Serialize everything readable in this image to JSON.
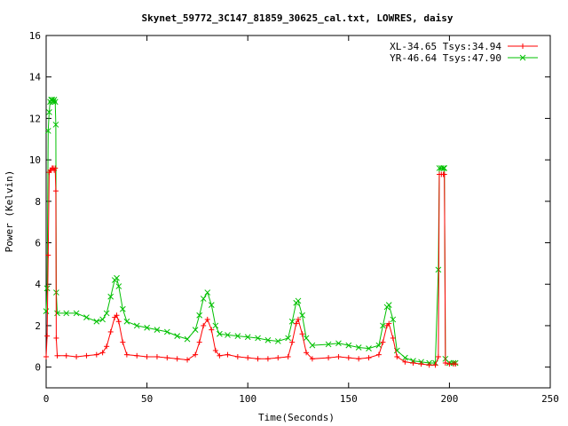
{
  "chart_data": {
    "type": "line",
    "title": "Skynet_59772_3C147_81859_30625_cal.txt, LOWRES, daisy",
    "xlabel": "Time(Seconds)",
    "ylabel": "Power (Kelvin)",
    "xlim": [
      0,
      250
    ],
    "ylim": [
      -1,
      16
    ],
    "xticks": [
      0,
      50,
      100,
      150,
      200,
      250
    ],
    "yticks": [
      0,
      2,
      4,
      6,
      8,
      10,
      12,
      14,
      16
    ],
    "grid": false,
    "legend_position": "top-right",
    "series": [
      {
        "name": "XL-34.65 Tsys:34.94",
        "color": "#ff0000",
        "marker": "plus",
        "points": [
          [
            0,
            0.5
          ],
          [
            0.5,
            1.5
          ],
          [
            1,
            5.4
          ],
          [
            1.5,
            9.4
          ],
          [
            2,
            9.5
          ],
          [
            2.5,
            9.5
          ],
          [
            3,
            9.6
          ],
          [
            3.5,
            9.6
          ],
          [
            4,
            9.5
          ],
          [
            4.5,
            9.6
          ],
          [
            4.8,
            8.5
          ],
          [
            5,
            1.4
          ],
          [
            5.5,
            0.55
          ],
          [
            10,
            0.55
          ],
          [
            15,
            0.5
          ],
          [
            20,
            0.55
          ],
          [
            25,
            0.6
          ],
          [
            28,
            0.7
          ],
          [
            30,
            1.0
          ],
          [
            32,
            1.7
          ],
          [
            34,
            2.4
          ],
          [
            35,
            2.5
          ],
          [
            36,
            2.2
          ],
          [
            38,
            1.2
          ],
          [
            40,
            0.6
          ],
          [
            45,
            0.55
          ],
          [
            50,
            0.5
          ],
          [
            55,
            0.5
          ],
          [
            60,
            0.45
          ],
          [
            65,
            0.4
          ],
          [
            70,
            0.35
          ],
          [
            74,
            0.6
          ],
          [
            76,
            1.2
          ],
          [
            78,
            2.0
          ],
          [
            80,
            2.3
          ],
          [
            82,
            1.8
          ],
          [
            84,
            0.8
          ],
          [
            86,
            0.55
          ],
          [
            90,
            0.6
          ],
          [
            95,
            0.5
          ],
          [
            100,
            0.45
          ],
          [
            105,
            0.4
          ],
          [
            110,
            0.4
          ],
          [
            115,
            0.45
          ],
          [
            120,
            0.5
          ],
          [
            122,
            1.2
          ],
          [
            124,
            2.1
          ],
          [
            125,
            2.3
          ],
          [
            127,
            1.6
          ],
          [
            129,
            0.7
          ],
          [
            132,
            0.4
          ],
          [
            140,
            0.45
          ],
          [
            145,
            0.5
          ],
          [
            150,
            0.45
          ],
          [
            155,
            0.4
          ],
          [
            160,
            0.45
          ],
          [
            165,
            0.6
          ],
          [
            167,
            1.2
          ],
          [
            169,
            2.0
          ],
          [
            170,
            2.1
          ],
          [
            172,
            1.4
          ],
          [
            174,
            0.5
          ],
          [
            178,
            0.25
          ],
          [
            182,
            0.2
          ],
          [
            186,
            0.15
          ],
          [
            190,
            0.1
          ],
          [
            193,
            0.1
          ],
          [
            194.5,
            0.5
          ],
          [
            195,
            9.3
          ],
          [
            196,
            9.3
          ],
          [
            197,
            9.3
          ],
          [
            197.5,
            9.3
          ],
          [
            198,
            0.2
          ],
          [
            200,
            0.15
          ],
          [
            202,
            0.15
          ],
          [
            203,
            0.15
          ]
        ]
      },
      {
        "name": "YR-46.64 Tsys:47.90",
        "color": "#00c000",
        "marker": "x",
        "points": [
          [
            0,
            2.7
          ],
          [
            0.5,
            3.8
          ],
          [
            1,
            11.4
          ],
          [
            1.5,
            12.3
          ],
          [
            2,
            12.8
          ],
          [
            2.5,
            12.9
          ],
          [
            3,
            12.9
          ],
          [
            3.5,
            12.8
          ],
          [
            4,
            12.9
          ],
          [
            4.5,
            12.8
          ],
          [
            4.8,
            11.7
          ],
          [
            5,
            3.6
          ],
          [
            5.5,
            2.6
          ],
          [
            10,
            2.6
          ],
          [
            15,
            2.6
          ],
          [
            20,
            2.4
          ],
          [
            25,
            2.2
          ],
          [
            28,
            2.3
          ],
          [
            30,
            2.6
          ],
          [
            32,
            3.4
          ],
          [
            34,
            4.2
          ],
          [
            35,
            4.3
          ],
          [
            36,
            3.9
          ],
          [
            38,
            2.8
          ],
          [
            40,
            2.2
          ],
          [
            45,
            2.0
          ],
          [
            50,
            1.9
          ],
          [
            55,
            1.8
          ],
          [
            60,
            1.7
          ],
          [
            65,
            1.5
          ],
          [
            70,
            1.35
          ],
          [
            74,
            1.8
          ],
          [
            76,
            2.5
          ],
          [
            78,
            3.3
          ],
          [
            80,
            3.6
          ],
          [
            82,
            3.0
          ],
          [
            84,
            2.0
          ],
          [
            86,
            1.6
          ],
          [
            90,
            1.55
          ],
          [
            95,
            1.5
          ],
          [
            100,
            1.45
          ],
          [
            105,
            1.4
          ],
          [
            110,
            1.3
          ],
          [
            115,
            1.25
          ],
          [
            120,
            1.4
          ],
          [
            122,
            2.2
          ],
          [
            124,
            3.1
          ],
          [
            125,
            3.2
          ],
          [
            127,
            2.5
          ],
          [
            129,
            1.4
          ],
          [
            132,
            1.05
          ],
          [
            140,
            1.1
          ],
          [
            145,
            1.15
          ],
          [
            150,
            1.05
          ],
          [
            155,
            0.95
          ],
          [
            160,
            0.9
          ],
          [
            165,
            1.05
          ],
          [
            167,
            2.0
          ],
          [
            169,
            2.9
          ],
          [
            170,
            3.0
          ],
          [
            172,
            2.3
          ],
          [
            174,
            0.8
          ],
          [
            178,
            0.45
          ],
          [
            182,
            0.3
          ],
          [
            186,
            0.25
          ],
          [
            190,
            0.2
          ],
          [
            193,
            0.2
          ],
          [
            194.5,
            4.7
          ],
          [
            195,
            9.6
          ],
          [
            196,
            9.6
          ],
          [
            197,
            9.6
          ],
          [
            197.5,
            9.6
          ],
          [
            198,
            0.4
          ],
          [
            200,
            0.2
          ],
          [
            202,
            0.2
          ],
          [
            203,
            0.2
          ]
        ]
      }
    ]
  }
}
